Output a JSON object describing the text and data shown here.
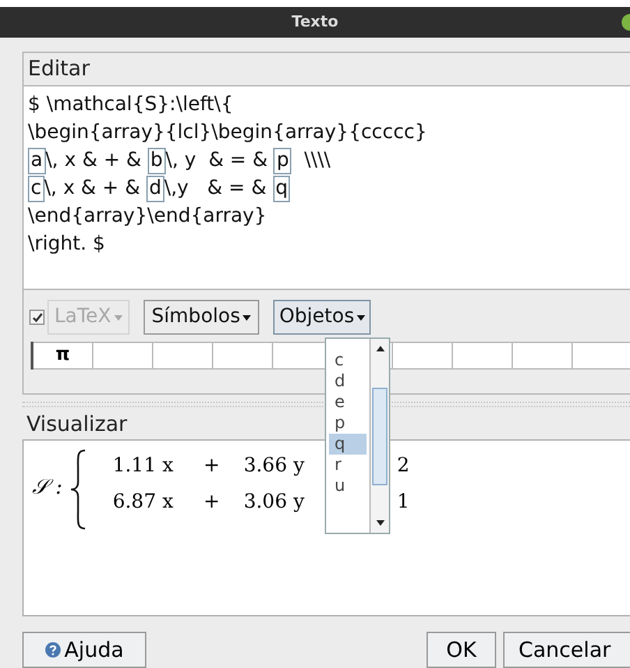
{
  "window": {
    "title": "Texto"
  },
  "editor": {
    "label": "Editar",
    "lines": [
      [
        {
          "kind": "text",
          "text": "$ \\mathcal{S}:\\left\\{"
        }
      ],
      [
        {
          "kind": "text",
          "text": "\\begin{array}{lcl}\\begin{array}{ccccc}"
        }
      ],
      [
        {
          "kind": "object",
          "text": "a"
        },
        {
          "kind": "text",
          "text": "\\, x & + & "
        },
        {
          "kind": "object",
          "text": "b"
        },
        {
          "kind": "text",
          "text": "\\, y  & = & "
        },
        {
          "kind": "object",
          "text": "p"
        },
        {
          "kind": "text",
          "text": "  \\\\\\\\"
        }
      ],
      [
        {
          "kind": "object",
          "text": "c"
        },
        {
          "kind": "text",
          "text": "\\, x & + & "
        },
        {
          "kind": "object",
          "text": "d"
        },
        {
          "kind": "text",
          "text": "\\,y   & = & "
        },
        {
          "kind": "object",
          "text": "q"
        }
      ],
      [
        {
          "kind": "text",
          "text": "\\end{array}\\end{array}"
        }
      ],
      [
        {
          "kind": "text",
          "text": "\\right. $"
        }
      ]
    ]
  },
  "toolbar": {
    "latex": {
      "label": "LaTeX",
      "checked": true,
      "disabled": true
    },
    "symbols_button": "Símbolos",
    "objects_button": "Objetos"
  },
  "symbols": [
    "π"
  ],
  "objects_list": {
    "items": [
      {
        "label": "c",
        "selected": false
      },
      {
        "label": "d",
        "selected": false
      },
      {
        "label": "e",
        "selected": false
      },
      {
        "label": "p",
        "selected": false
      },
      {
        "label": "q",
        "selected": true
      },
      {
        "label": "r",
        "selected": false
      },
      {
        "label": "u",
        "selected": false
      }
    ]
  },
  "preview": {
    "label": "Visualizar",
    "lhs": "𝒮 :",
    "rows": [
      [
        "1.11 x",
        "+",
        "3.66 y",
        "2"
      ],
      [
        "6.87 x",
        "+",
        "3.06 y",
        "1"
      ]
    ]
  },
  "buttons": {
    "help": "Ajuda",
    "ok": "OK",
    "cancel": "Cancelar"
  }
}
